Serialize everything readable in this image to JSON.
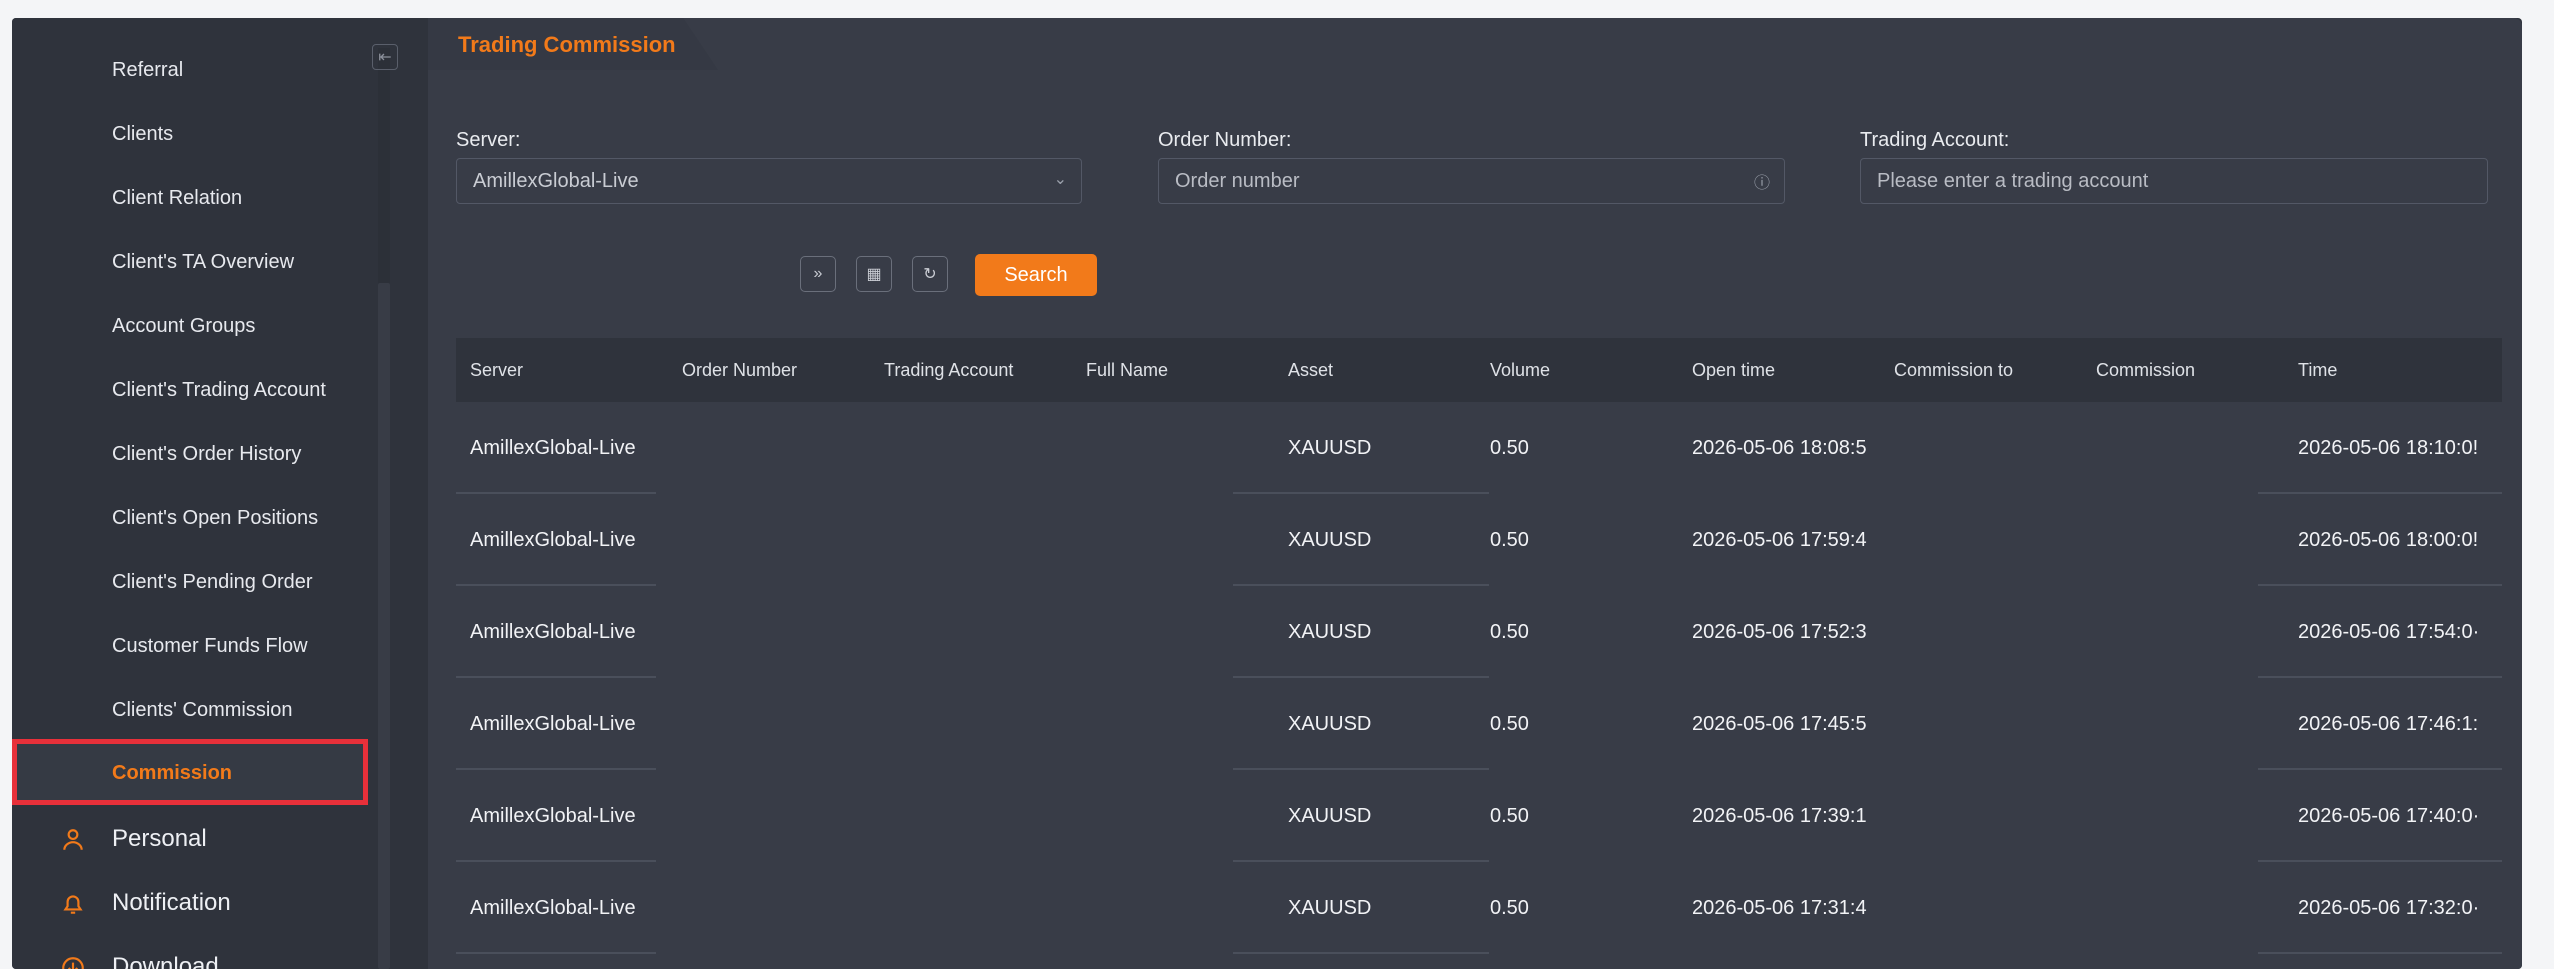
{
  "sidebar": {
    "items": [
      {
        "label": "Referral"
      },
      {
        "label": "Clients"
      },
      {
        "label": "Client Relation"
      },
      {
        "label": "Client's TA Overview"
      },
      {
        "label": "Account Groups"
      },
      {
        "label": "Client's Trading Account"
      },
      {
        "label": "Client's Order History"
      },
      {
        "label": "Client's Open Positions"
      },
      {
        "label": "Client's Pending Order"
      },
      {
        "label": "Customer Funds Flow"
      },
      {
        "label": "Clients' Commission"
      },
      {
        "label": "Commission"
      }
    ],
    "top_items": [
      {
        "label": "Personal",
        "icon": "personal-icon"
      },
      {
        "label": "Notification",
        "icon": "notification-icon"
      },
      {
        "label": "Download",
        "icon": "download-icon"
      }
    ],
    "collapse_icon": "collapse-icon"
  },
  "page": {
    "title": "Trading Commission"
  },
  "filters": {
    "server": {
      "label": "Server:",
      "value": "AmillexGlobal-Live"
    },
    "order_number": {
      "label": "Order Number:",
      "placeholder": "Order number"
    },
    "trading_account": {
      "label": "Trading Account:",
      "placeholder": "Please enter a trading account"
    },
    "search_label": "Search"
  },
  "table": {
    "headers": [
      "Server",
      "Order Number",
      "Trading Account",
      "Full Name",
      "Asset",
      "Volume",
      "Open time",
      "Commission to",
      "Commission",
      "Time"
    ],
    "rows": [
      {
        "server": "AmillexGlobal-Live",
        "asset": "XAUUSD",
        "volume": "0.50",
        "open_time": "2026-05-06 18:08:5",
        "time": "2026-05-06 18:10:0!"
      },
      {
        "server": "AmillexGlobal-Live",
        "asset": "XAUUSD",
        "volume": "0.50",
        "open_time": "2026-05-06 17:59:4",
        "time": "2026-05-06 18:00:0!"
      },
      {
        "server": "AmillexGlobal-Live",
        "asset": "XAUUSD",
        "volume": "0.50",
        "open_time": "2026-05-06 17:52:3",
        "time": "2026-05-06 17:54:0·"
      },
      {
        "server": "AmillexGlobal-Live",
        "asset": "XAUUSD",
        "volume": "0.50",
        "open_time": "2026-05-06 17:45:5",
        "time": "2026-05-06 17:46:1:"
      },
      {
        "server": "AmillexGlobal-Live",
        "asset": "XAUUSD",
        "volume": "0.50",
        "open_time": "2026-05-06 17:39:1",
        "time": "2026-05-06 17:40:0·"
      },
      {
        "server": "AmillexGlobal-Live",
        "asset": "XAUUSD",
        "volume": "0.50",
        "open_time": "2026-05-06 17:31:4",
        "time": "2026-05-06 17:32:0·"
      }
    ]
  },
  "colors": {
    "accent": "#f27a1a",
    "highlight": "#e8303a",
    "panel": "#383c47",
    "sidebar": "#2f333c"
  }
}
